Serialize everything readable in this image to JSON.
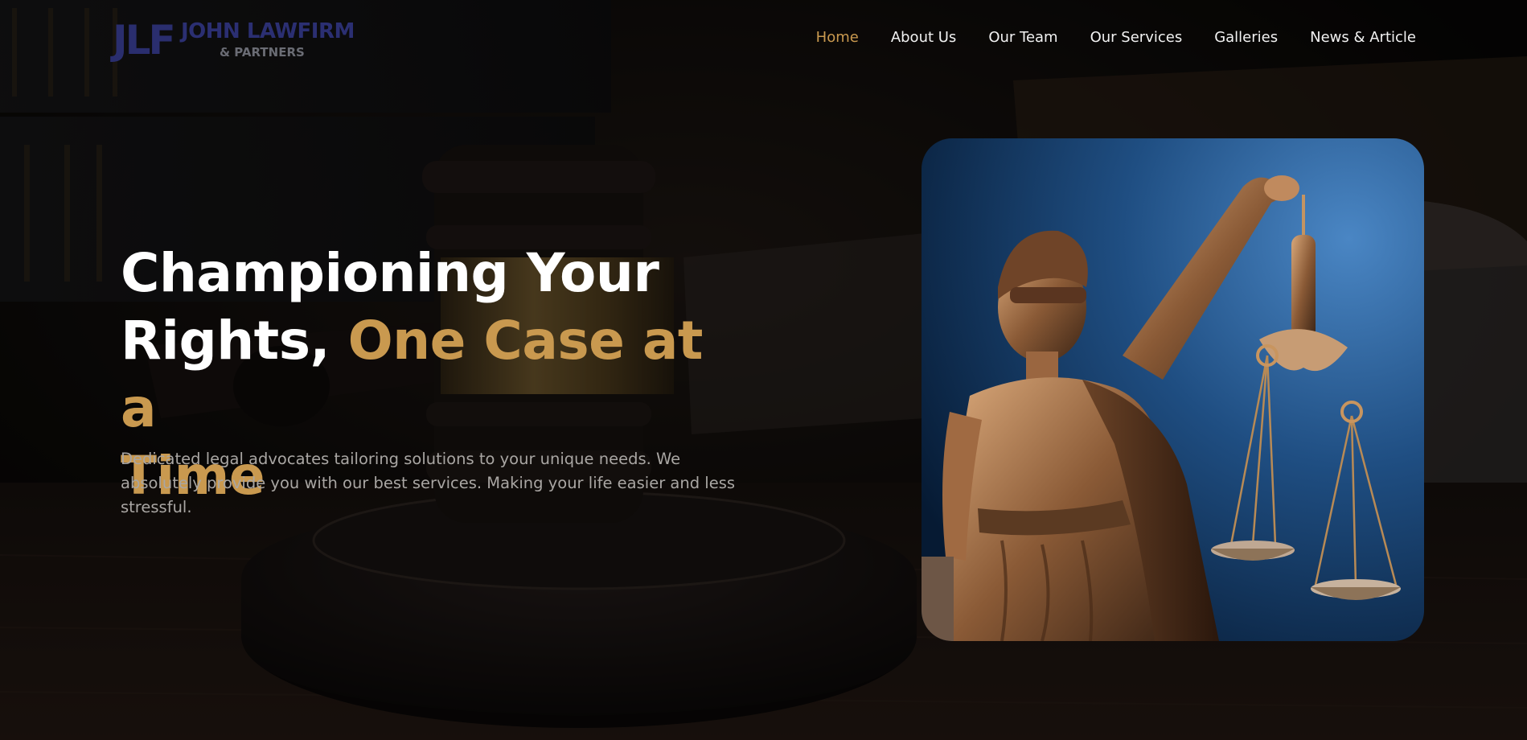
{
  "brand": {
    "mark": "JLF",
    "name": "JOHN LAWFIRM",
    "tagline": "& PARTNERS"
  },
  "nav": {
    "items": [
      {
        "label": "Home",
        "active": true
      },
      {
        "label": "About Us",
        "active": false
      },
      {
        "label": "Our Team",
        "active": false
      },
      {
        "label": "Our Services",
        "active": false
      },
      {
        "label": "Galleries",
        "active": false
      },
      {
        "label": "News & Article",
        "active": false
      }
    ]
  },
  "hero": {
    "title_line1": "Championing Your",
    "title_line2_white": "Rights, ",
    "title_line2_accent": "One Case at a",
    "title_line3_accent": "Time",
    "description": "Dedicated legal advocates tailoring solutions to your unique needs. We absolutely provide you with our best services. Making your life easier and less stressful."
  },
  "colors": {
    "accent": "#c9994f",
    "brand": "#2b2f72",
    "background": "#0d0b0a",
    "nav_text": "#f2f2f2"
  },
  "icons": {
    "hero_image": "lady-justice-statue-image",
    "background_image": "judge-gavel-background-image"
  }
}
